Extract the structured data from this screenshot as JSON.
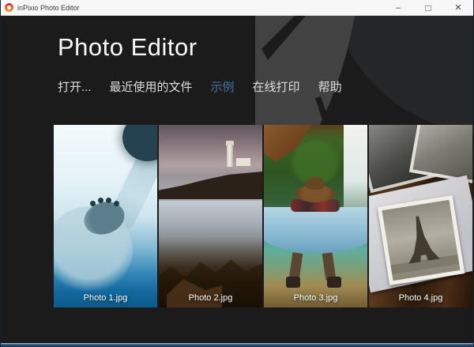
{
  "window": {
    "title": "inPixio Photo Editor",
    "controls": {
      "minimize": "–",
      "maximize": "□",
      "close": "✕"
    }
  },
  "header": {
    "title": "Photo Editor"
  },
  "menu": {
    "items": [
      {
        "label": "打开...",
        "active": false
      },
      {
        "label": "最近使用的文件",
        "active": false
      },
      {
        "label": "示例",
        "active": true
      },
      {
        "label": "在线打印",
        "active": false
      },
      {
        "label": "帮助",
        "active": false
      }
    ]
  },
  "gallery": {
    "photos": [
      {
        "label": "Photo 1.jpg",
        "subject": "polar-bear-swimming-underwater"
      },
      {
        "label": "Photo 2.jpg",
        "subject": "lighthouse-on-rocky-coast"
      },
      {
        "label": "Photo 3.jpg",
        "subject": "person-in-hammock-by-waterfall"
      },
      {
        "label": "Photo 4.jpg",
        "subject": "vintage-photos-on-wooden-table"
      }
    ]
  },
  "colors": {
    "background": "#1b1b1b",
    "menu_active": "#46729e",
    "menu_text": "#dedede",
    "titlebar": "#f7f7f7",
    "aperture_blade": "#424242",
    "bottom_border_blue": "#3a608c"
  }
}
